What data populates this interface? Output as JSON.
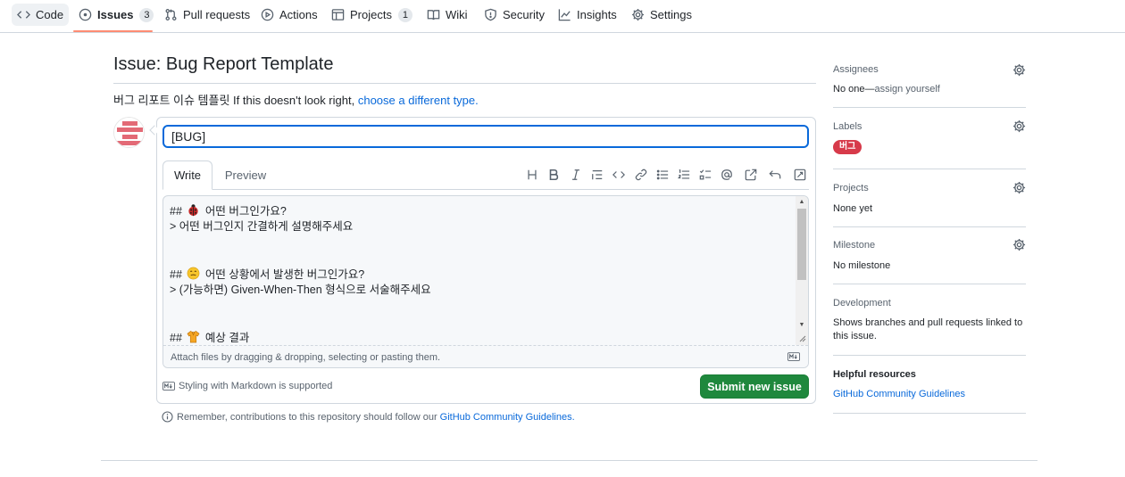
{
  "nav": {
    "items": [
      {
        "label": "Code",
        "count": ""
      },
      {
        "label": "Issues",
        "count": "3"
      },
      {
        "label": "Pull requests",
        "count": ""
      },
      {
        "label": "Actions",
        "count": ""
      },
      {
        "label": "Projects",
        "count": "1"
      },
      {
        "label": "Wiki",
        "count": ""
      },
      {
        "label": "Security",
        "count": ""
      },
      {
        "label": "Insights",
        "count": ""
      },
      {
        "label": "Settings",
        "count": ""
      }
    ],
    "active": "Issues",
    "active_underline_color": "#fd8c73"
  },
  "main": {
    "title": "Issue: Bug Report Template",
    "template_text": "버그 리포트 이슈 템플릿 If this doesn't look right,",
    "template_link": "choose a different type.",
    "title_input_value": "[BUG]",
    "tabs": {
      "write": "Write",
      "preview": "Preview"
    },
    "toolbar_icons": [
      "heading-icon",
      "bold-icon",
      "italic-icon",
      "quote-icon",
      "code-icon",
      "link-icon",
      "bulleted-list-icon",
      "numbered-list-icon",
      "task-list-icon",
      "mention-icon",
      "reference-icon",
      "undo-icon",
      "fullscreen-icon"
    ],
    "body_lines": [
      {
        "prefix": "##",
        "emoji": "ladybug",
        "text": "어떤 버그인가요?"
      },
      {
        "prefix": "",
        "emoji": "",
        "text": "> 어떤 버그인지 간결하게 설명해주세요"
      },
      {
        "prefix": "",
        "emoji": "",
        "text": ""
      },
      {
        "prefix": "",
        "emoji": "",
        "text": ""
      },
      {
        "prefix": "##",
        "emoji": "face",
        "text": "어떤 상황에서 발생한 버그인가요?"
      },
      {
        "prefix": "",
        "emoji": "",
        "text": "> (가능하면) Given-When-Then 형식으로 서술해주세요"
      },
      {
        "prefix": "",
        "emoji": "",
        "text": ""
      },
      {
        "prefix": "",
        "emoji": "",
        "text": ""
      },
      {
        "prefix": "##",
        "emoji": "shirt",
        "text": "예상 결과"
      }
    ],
    "attach_text": "Attach files by dragging & dropping, selecting or pasting them.",
    "markdown_note": "Styling with Markdown is supported",
    "submit_label": "Submit new issue",
    "submit_color": "#1f883d",
    "remember_text": "Remember, contributions to this repository should follow our",
    "remember_link": "GitHub Community Guidelines."
  },
  "sidebar": {
    "assignees": {
      "heading": "Assignees",
      "value": "No one—",
      "link": "assign yourself"
    },
    "labels": {
      "heading": "Labels",
      "label": "버그",
      "label_color": "#d73a4a"
    },
    "projects": {
      "heading": "Projects",
      "value": "None yet"
    },
    "milestone": {
      "heading": "Milestone",
      "value": "No milestone"
    },
    "development": {
      "heading": "Development",
      "value": "Shows branches and pull requests linked to this issue."
    },
    "helpful": {
      "heading": "Helpful resources",
      "link": "GitHub Community Guidelines"
    }
  },
  "accent_link_color": "#0969da"
}
